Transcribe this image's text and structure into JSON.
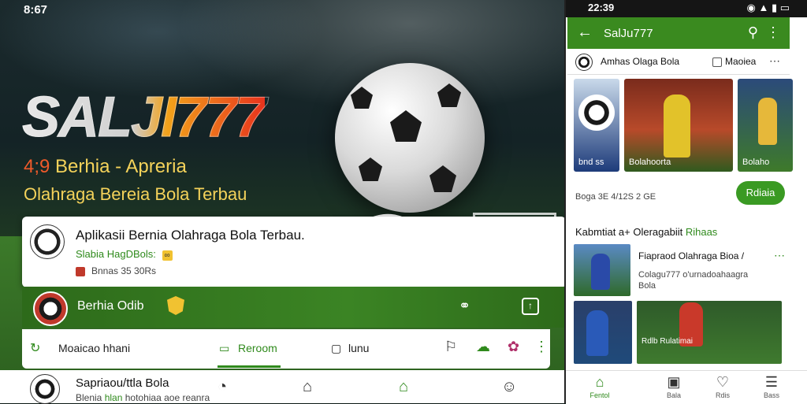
{
  "status_left": {
    "time": "8:67"
  },
  "hero": {
    "logo": "SALJI777",
    "tag_number": "4;9",
    "tag_line1": "Berhia - Apreria",
    "tag_line2": "Olahraga Bereia Bola Terbau"
  },
  "card": {
    "title": "Aplikasii Bernia Olahraga Bola Terbau.",
    "subtitle": "Slabia HagDBols:",
    "badge": "∞",
    "meta": "Bnnas 35 30Rs"
  },
  "greenbar": {
    "label": "Berhia Odib"
  },
  "toolbar": {
    "item1": "Moaicao hhani",
    "item2": "Reroom",
    "item3": "lunu"
  },
  "bottom": {
    "title": "Sapriaou/ttla Bola",
    "subtitle_a": "Blenia",
    "subtitle_hl": "hlan",
    "subtitle_b": "hotohiaa aoe reanra"
  },
  "phone": {
    "status": {
      "time": "22:39"
    },
    "header": {
      "title": "SalJu777"
    },
    "section": {
      "label": "Amhas Olaga Bola",
      "checkbox": "Maoiea"
    },
    "thumbs": [
      {
        "caption": "bnd ss"
      },
      {
        "caption": "Bolahoorta"
      },
      {
        "caption": "Bolaho"
      }
    ],
    "meta": "Boga 3E  4/12S  2 GE",
    "install_label": "Rdiaia",
    "list_head": "Kabmtiat a+ Oleragabiit",
    "list_head_hl": "Rihaas",
    "item1": {
      "title": "Fiapraod Olahraga Bioa /",
      "subtitle": "Colagu777 o'urnadoahaagra Bola"
    },
    "item2": {
      "caption": "Rdlb Rulatimai"
    },
    "nav": [
      {
        "label": "Fentol"
      },
      {
        "label": "Bala"
      },
      {
        "label": "Rdis"
      },
      {
        "label": "Bass"
      }
    ]
  },
  "colors": {
    "brand_green": "#3a8a1f",
    "accent_orange": "#ef5a2a",
    "accent_yellow": "#f4d25a"
  }
}
